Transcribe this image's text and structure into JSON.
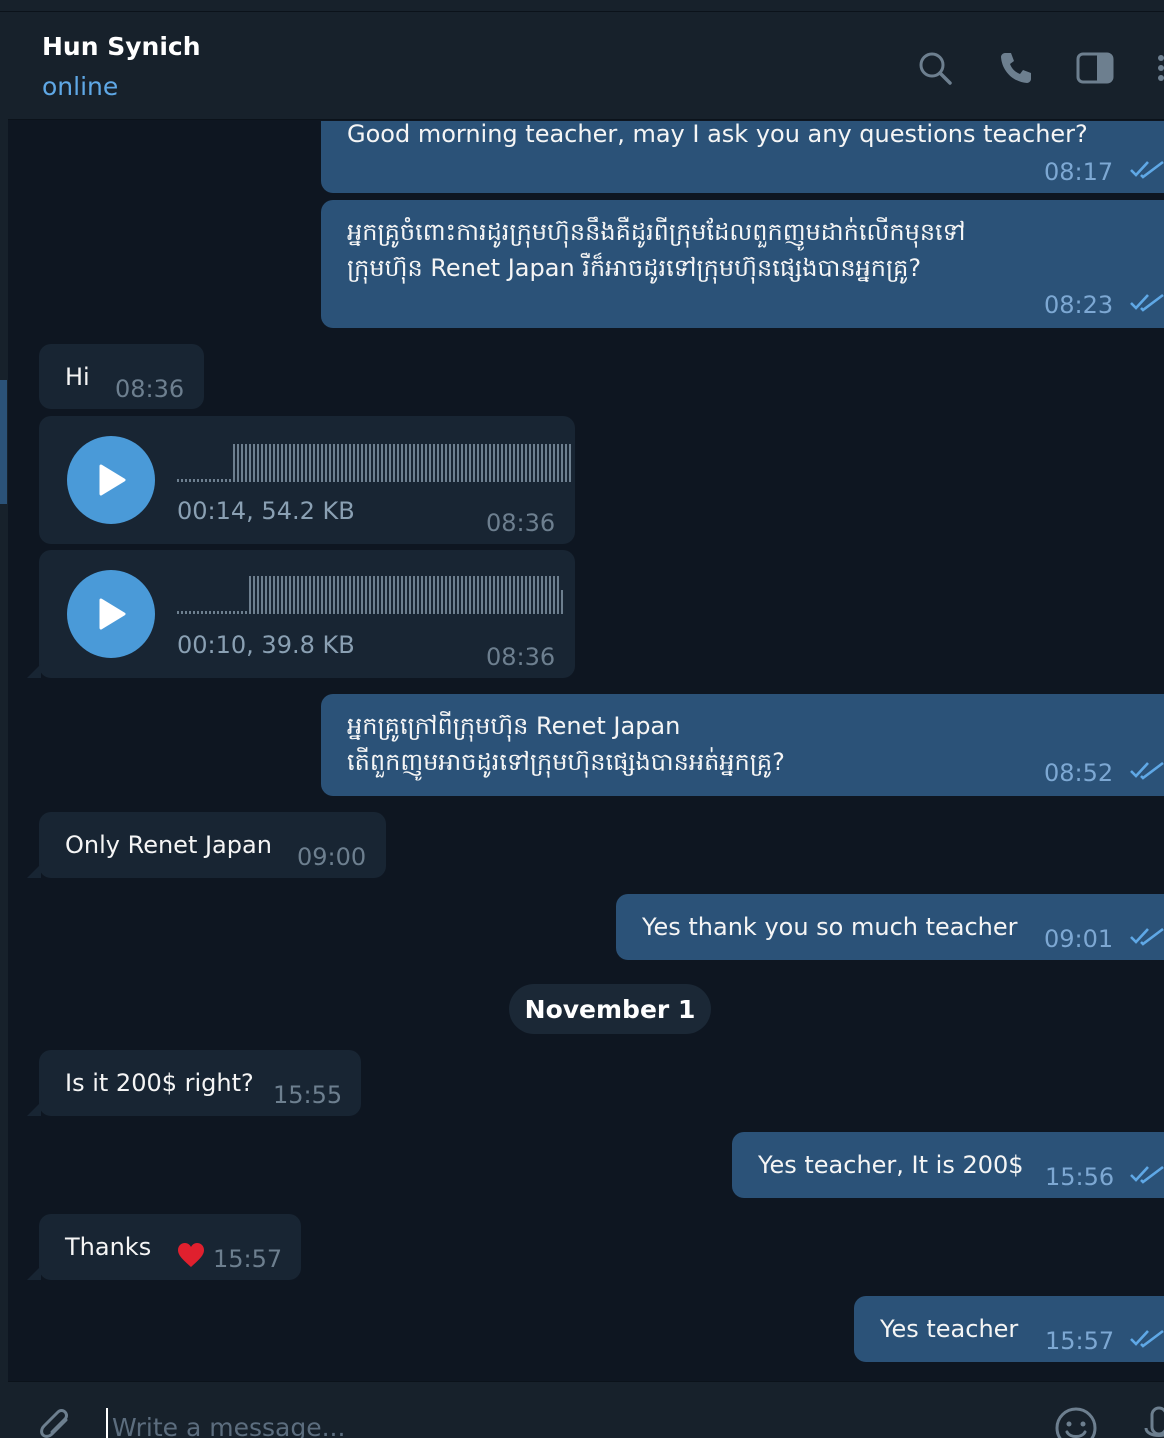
{
  "header": {
    "contact_name": "Hun Synich",
    "status": "online",
    "icons": [
      "search-icon",
      "phone-icon",
      "sidebar-toggle-icon",
      "more-icon"
    ]
  },
  "messages": {
    "m1": {
      "text": "Good morning teacher, may I ask you any questions teacher?",
      "time": "08:17",
      "direction": "outgoing",
      "read": true
    },
    "m2": {
      "line1": "អ្នកគ្រូចំពោះការដូរក្រុមហ៊ុននឹងគឺដូរពីក្រុមដែលពួកញូមដាក់លើកមុនទៅ",
      "line2": "ក្រុមហ៊ុន Renet Japan  រឺក៏អាចដូរទៅក្រុមហ៊ុនផ្សេងបានអ្នកគ្រូ?",
      "time": "08:23",
      "direction": "outgoing",
      "read": true
    },
    "m3": {
      "text": "Hi",
      "time": "08:36",
      "direction": "incoming"
    },
    "m4": {
      "meta": "00:14, 54.2 KB",
      "time": "08:36",
      "direction": "incoming",
      "kind": "voice"
    },
    "m5": {
      "meta": "00:10, 39.8 KB",
      "time": "08:36",
      "direction": "incoming",
      "kind": "voice"
    },
    "m6": {
      "line1": "អ្នកគ្រូក្រៅពីក្រុមហ៊ុន Renet Japan",
      "line2": "តើពួកញូមអាចដូរទៅក្រុមហ៊ុនផ្សេងបានអត់អ្នកគ្រូ?",
      "time": "08:52",
      "direction": "outgoing",
      "read": true
    },
    "m7": {
      "text": "Only Renet Japan",
      "time": "09:00",
      "direction": "incoming"
    },
    "m8": {
      "text": "Yes thank you so much teacher",
      "time": "09:01",
      "direction": "outgoing",
      "read": true
    },
    "date_separator": "November 1",
    "m9": {
      "text": "Is it 200$ right?",
      "time": "15:55",
      "direction": "incoming"
    },
    "m10": {
      "text": "Yes teacher, It is 200$",
      "time": "15:56",
      "direction": "outgoing",
      "read": true
    },
    "m11": {
      "text": "Thanks",
      "reaction": "heart",
      "time": "15:57",
      "direction": "incoming"
    },
    "m12": {
      "text": "Yes teacher",
      "time": "15:57",
      "direction": "outgoing",
      "read": true
    }
  },
  "composer": {
    "placeholder": "Write a message..."
  },
  "colors": {
    "background": "#0e1621",
    "panel": "#17212b",
    "outgoing_bubble": "#2b5278",
    "incoming_bubble": "#182533",
    "accent": "#5fa8e6",
    "play_button": "#4a9ad8",
    "reaction_heart": "#e0202e"
  }
}
